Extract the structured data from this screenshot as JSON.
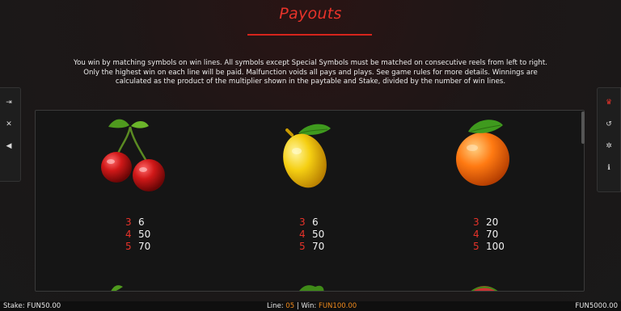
{
  "header": {
    "title": "Payouts"
  },
  "intro_text": "You win by matching symbols on win lines. All symbols except Special Symbols must be matched on consecutive reels from left to right. Only the highest win on each line will be paid. Malfunction voids all pays and plays. See game rules for more details. Winnings are calculated as the product of the multiplier shown in the paytable and Stake, divided by the number of win lines.",
  "left_toolbar": [
    {
      "name": "exit-icon",
      "glyph": "⇥"
    },
    {
      "name": "close-icon",
      "glyph": "✕"
    },
    {
      "name": "sound-icon",
      "glyph": "◀"
    }
  ],
  "right_toolbar": [
    {
      "name": "trophy-icon",
      "glyph": "♛",
      "active": true
    },
    {
      "name": "history-icon",
      "glyph": "↺"
    },
    {
      "name": "settings-icon",
      "glyph": "✲"
    },
    {
      "name": "info-icon",
      "glyph": "ℹ"
    }
  ],
  "symbols": [
    {
      "name": "cherry",
      "pays": [
        {
          "count": "3",
          "amount": "6"
        },
        {
          "count": "4",
          "amount": "50"
        },
        {
          "count": "5",
          "amount": "70"
        }
      ]
    },
    {
      "name": "lemon",
      "pays": [
        {
          "count": "3",
          "amount": "6"
        },
        {
          "count": "4",
          "amount": "50"
        },
        {
          "count": "5",
          "amount": "70"
        }
      ]
    },
    {
      "name": "orange",
      "pays": [
        {
          "count": "3",
          "amount": "20"
        },
        {
          "count": "4",
          "amount": "70"
        },
        {
          "count": "5",
          "amount": "100"
        }
      ]
    }
  ],
  "footer": {
    "stake_label": "Stake:",
    "stake_value": "FUN50.00",
    "line_label": "Line:",
    "line_value": "05",
    "separator": "|",
    "win_label": "Win:",
    "win_value": "FUN100.00",
    "balance_value": "FUN5000.00"
  },
  "colors": {
    "accent": "#e8332a",
    "highlight": "#f08a1c"
  }
}
